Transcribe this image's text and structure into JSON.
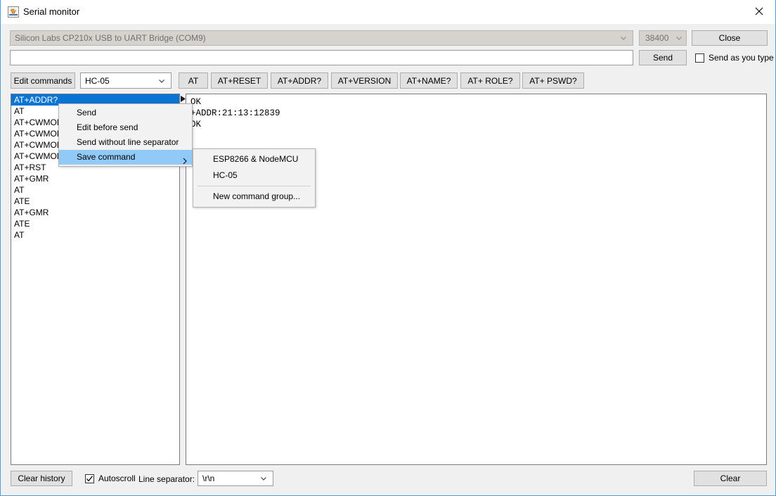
{
  "window": {
    "title": "Serial monitor",
    "icon": "java-coffee-cup-icon",
    "close_icon": "close-icon",
    "border_color": "#4a9fd8"
  },
  "connection": {
    "port_value": "Silicon Labs CP210x USB to UART Bridge (COM9)",
    "baud_value": "38400",
    "close_label": "Close"
  },
  "send_row": {
    "input_value": "",
    "input_placeholder": "",
    "send_label": "Send",
    "send_as_you_type_label": "Send as you type",
    "send_as_you_type_checked": false
  },
  "commands_bar": {
    "edit_commands_label": "Edit commands",
    "group_value": "HC-05",
    "buttons": [
      {
        "label": "AT"
      },
      {
        "label": "AT+RESET"
      },
      {
        "label": "AT+ADDR?"
      },
      {
        "label": "AT+VERSION"
      },
      {
        "label": "AT+NAME?"
      },
      {
        "label": "AT+ ROLE?"
      },
      {
        "label": "AT+ PSWD?"
      }
    ]
  },
  "history": {
    "items": [
      {
        "label": "AT+ADDR?",
        "selected": true
      },
      {
        "label": "AT",
        "selected": false
      },
      {
        "label": "AT+CWMODE",
        "selected": false
      },
      {
        "label": "AT+CWMODE",
        "selected": false
      },
      {
        "label": "AT+CWMODE",
        "selected": false
      },
      {
        "label": "AT+CWMODE",
        "selected": false
      },
      {
        "label": "AT+RST",
        "selected": false
      },
      {
        "label": "AT+GMR",
        "selected": false
      },
      {
        "label": "AT",
        "selected": false
      },
      {
        "label": "ATE",
        "selected": false
      },
      {
        "label": "AT+GMR",
        "selected": false
      },
      {
        "label": "ATE",
        "selected": false
      },
      {
        "label": "AT",
        "selected": false
      }
    ]
  },
  "terminal": {
    "text": "OK\n+ADDR:21:13:12839\nOK"
  },
  "context_menu": {
    "items": [
      {
        "label": "Send",
        "highlighted": false,
        "submenu": false
      },
      {
        "label": "Edit before send",
        "highlighted": false,
        "submenu": false
      },
      {
        "label": "Send without line separator",
        "highlighted": false,
        "submenu": false
      },
      {
        "label": "Save command",
        "highlighted": true,
        "submenu": true
      }
    ]
  },
  "submenu": {
    "items": [
      {
        "label": "ESP8266 & NodeMCU",
        "separator_after": false
      },
      {
        "label": "HC-05",
        "separator_after": true
      },
      {
        "label": "New command group...",
        "separator_after": false
      }
    ]
  },
  "footer": {
    "clear_history_label": "Clear history",
    "autoscroll_label": "Autoscroll",
    "autoscroll_checked": true,
    "line_separator_label": "Line separator:",
    "line_separator_value": "\\r\\n",
    "clear_label": "Clear"
  },
  "colors": {
    "selection": "#0a74d4",
    "menu_highlight": "#91c9f7",
    "button_face": "#e1e1e1",
    "window_bg": "#f0f0f0"
  }
}
